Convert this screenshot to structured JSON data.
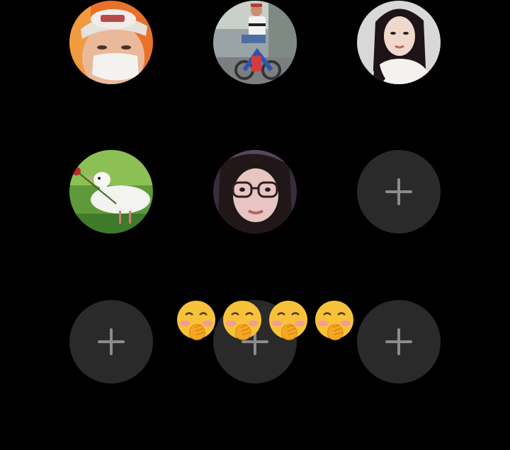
{
  "grid": {
    "avatars": [
      {
        "icon": "avatar-man-cap-mask"
      },
      {
        "icon": "avatar-man-on-bike"
      },
      {
        "icon": "avatar-woman-long-hair"
      },
      {
        "icon": "avatar-white-dove-rose"
      },
      {
        "icon": "avatar-girl-glasses"
      }
    ],
    "empty_slots": [
      {
        "icon": "plus-icon"
      },
      {
        "icon": "plus-icon"
      },
      {
        "icon": "plus-icon"
      },
      {
        "icon": "plus-icon"
      }
    ]
  },
  "reaction": {
    "emoji": "hand-over-mouth-emoji",
    "count": 4
  },
  "colors": {
    "background": "#000000",
    "empty_slot": "#2a2a2a",
    "plus": "#8c8c8c",
    "emoji_face": "#f7c23a"
  }
}
